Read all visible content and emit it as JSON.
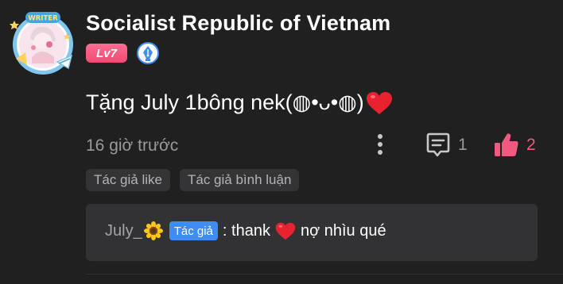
{
  "user": {
    "name": "Socialist Republic of Vietnam",
    "level": "Lv7",
    "avatar_badge_text": "WRITER"
  },
  "comment": {
    "text": "Tặng July 1bông nek(◍•ᴗ•◍)",
    "timestamp": "16 giờ trước",
    "reply_count": "1",
    "like_count": "2"
  },
  "chips": [
    {
      "label": "Tác giả like"
    },
    {
      "label": "Tác giả bình luận"
    }
  ],
  "reply": {
    "author": "July_",
    "author_tag": "Tác giả",
    "text_before": ": thank",
    "text_after": "nợ nhìu qué"
  },
  "colors": {
    "background": "#202021",
    "level_badge": "#f24a72",
    "writer_badge": "#3f8cf5",
    "like_active": "#f05a7e",
    "author_tag": "#3f8cf5",
    "heart": "#e8232f"
  },
  "icons": {
    "more": "more-vertical-icon",
    "reply": "comment-icon",
    "like": "thumbs-up-icon",
    "writer": "fountain-pen-icon"
  }
}
